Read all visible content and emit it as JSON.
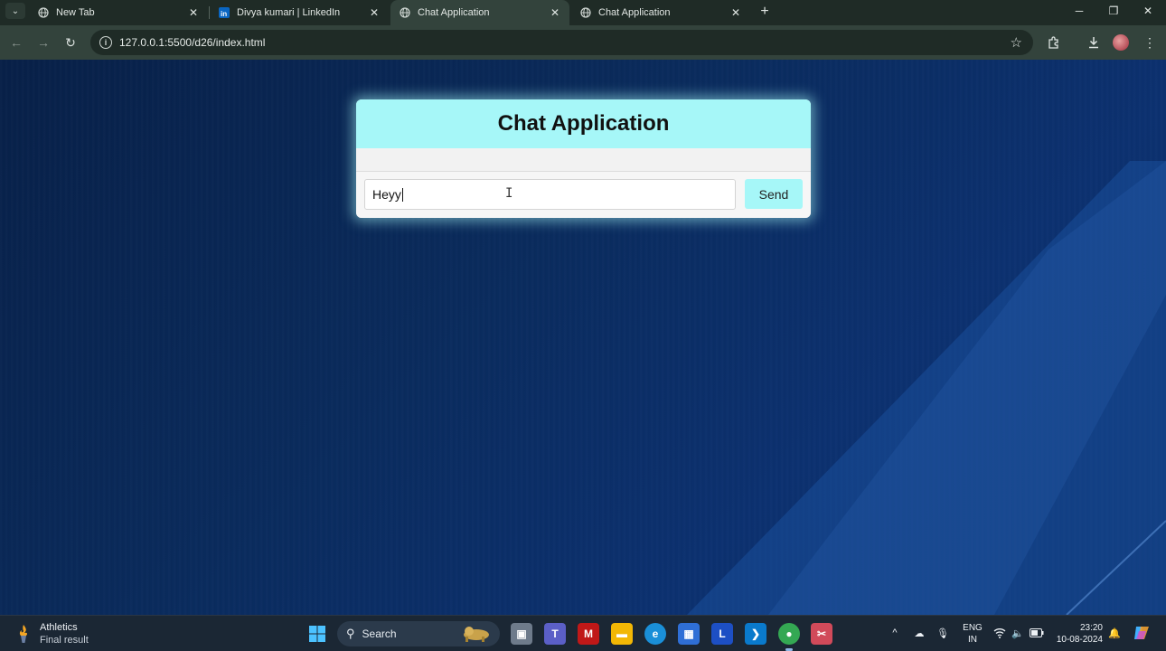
{
  "browser": {
    "tabs": [
      {
        "title": "New Tab",
        "icon": "globe-icon",
        "active": false
      },
      {
        "title": "Divya kumari | LinkedIn",
        "icon": "linkedin-icon",
        "active": false
      },
      {
        "title": "Chat Application",
        "icon": "globe-icon",
        "active": true
      },
      {
        "title": "Chat Application",
        "icon": "globe-icon",
        "active": false
      }
    ],
    "url": "127.0.0.1:5500/d26/index.html"
  },
  "chat": {
    "title": "Chat Application",
    "input_value": "Heyy",
    "send_label": "Send"
  },
  "taskbar": {
    "weather_title": "Athletics",
    "weather_sub": "Final result",
    "search_placeholder": "Search",
    "lang_top": "ENG",
    "lang_bottom": "IN",
    "time": "23:20",
    "date": "10-08-2024"
  },
  "colors": {
    "accent": "#a6f7f8",
    "background": "#0a2b5c"
  }
}
